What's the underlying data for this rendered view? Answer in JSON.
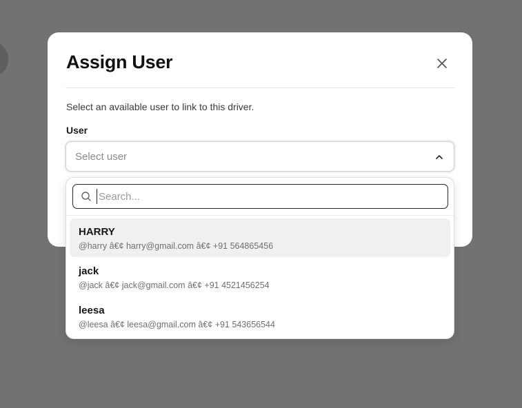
{
  "dialog": {
    "title": "Assign User",
    "description": "Select an available user to link to this driver.",
    "field_label": "User",
    "select_placeholder": "Select user"
  },
  "dropdown": {
    "search_placeholder": "Search...",
    "options": [
      {
        "name": "HARRY",
        "meta": "@harry â€¢ harry@gmail.com â€¢ +91 564865456"
      },
      {
        "name": "jack",
        "meta": "@jack â€¢ jack@gmail.com â€¢ +91 4521456254"
      },
      {
        "name": "leesa",
        "meta": "@leesa â€¢ leesa@gmail.com â€¢ +91 543656544"
      }
    ]
  },
  "icons": {
    "close": "close-icon",
    "chevron": "chevron-up-icon",
    "search": "search-icon"
  },
  "colors": {
    "overlay": "#727272",
    "modal_bg": "#ffffff",
    "option_highlight": "#f0f0f0",
    "text_primary": "#111111",
    "text_muted": "#6f6f6f"
  }
}
